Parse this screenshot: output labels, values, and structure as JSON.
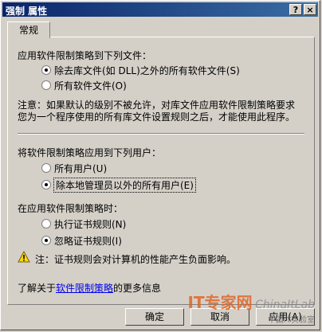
{
  "window": {
    "title": "强制 属性",
    "help_label": "?",
    "close_label": "×"
  },
  "tab": {
    "label": "常规"
  },
  "section1": {
    "heading": "应用软件限制策略到下列文件：",
    "options": [
      {
        "label": "除去库文件(如 DLL)之外的所有软件文件(S)",
        "selected": true
      },
      {
        "label": "所有软件文件(O)",
        "selected": false
      }
    ]
  },
  "note": {
    "line1": "注意：如果默认的级别不被允许，对库文件应用软件限制策略要求",
    "line2": "您为一个程序使用的所有库文件设置规则之后，才能使用此程序。"
  },
  "section2": {
    "heading": "将软件限制策略应用到下列用户：",
    "options": [
      {
        "label": "所有用户(U)",
        "selected": false
      },
      {
        "label": "除本地管理员以外的所有用户(E)",
        "selected": true
      }
    ]
  },
  "section3": {
    "heading": "在应用软件限制策略时：",
    "options": [
      {
        "label": "执行证书规则(N)",
        "selected": false
      },
      {
        "label": "忽略证书规则(I)",
        "selected": true
      }
    ]
  },
  "warning": {
    "text": "注：证书规则会对计算机的性能产生负面影响。"
  },
  "learn_more": {
    "prefix": "了解关于",
    "link": "软件限制策略",
    "suffix": "的更多信息"
  },
  "buttons": {
    "ok": "确定",
    "cancel": "取消",
    "apply": "应用(A)"
  },
  "watermark": {
    "left": "IT专家网",
    "right": "ChinaItLab",
    "sub": "中国IT实验室"
  }
}
